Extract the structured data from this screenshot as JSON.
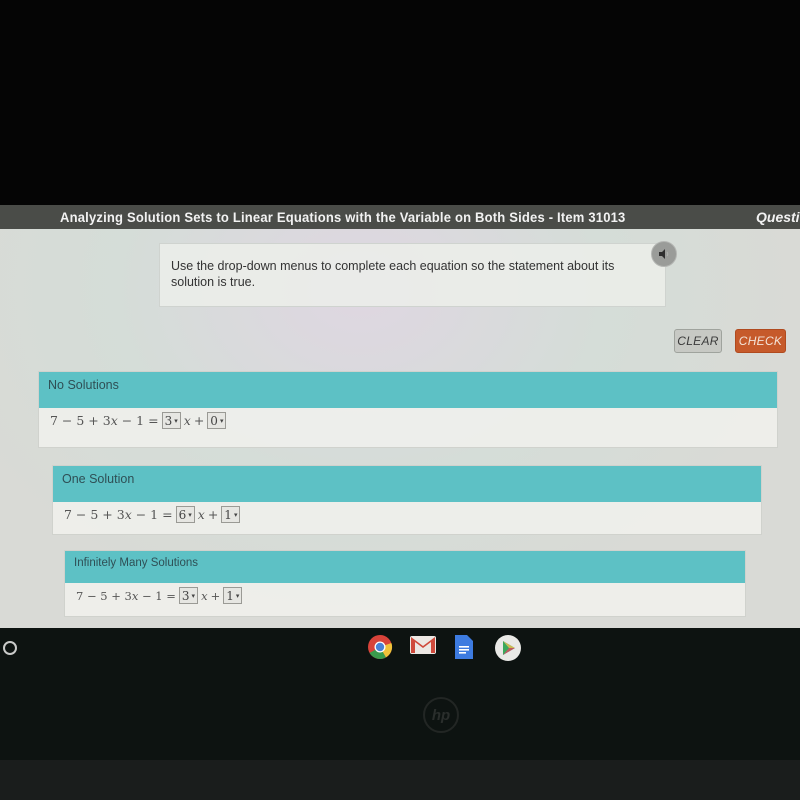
{
  "header": {
    "title": "Analyzing Solution Sets to Linear Equations with the Variable on Both Sides - Item 31013",
    "right_label": "Questic"
  },
  "prompt": {
    "text": "Use the drop-down menus to complete each equation so the statement about its solution is true.",
    "audio_icon": "speaker-icon"
  },
  "buttons": {
    "clear": "CLEAR",
    "check": "CHECK"
  },
  "panels": [
    {
      "heading": "No Solutions",
      "lhs": "7 − 5 + 3",
      "lhs_var": "x",
      "lhs_tail": " − 1 =",
      "coef": "3",
      "var": "x",
      "plus": "+",
      "const": "0"
    },
    {
      "heading": "One Solution",
      "lhs": "7 − 5 + 3",
      "lhs_var": "x",
      "lhs_tail": " − 1 =",
      "coef": "6",
      "var": "x",
      "plus": "+",
      "const": "1"
    },
    {
      "heading": "Infinitely Many Solutions",
      "lhs": "7 − 5 + 3",
      "lhs_var": "x",
      "lhs_tail": " − 1 =",
      "coef": "3",
      "var": "x",
      "plus": "+",
      "const": "1"
    }
  ],
  "dropdown_arrow": "▾",
  "shelf": {
    "apps": [
      "chrome-icon",
      "gmail-icon",
      "docs-icon",
      "play-store-icon"
    ],
    "logo": "hp"
  },
  "colors": {
    "panel_header": "#5dc1c5",
    "check_button": "#c65a2b",
    "title_bar": "#4a4c48"
  }
}
